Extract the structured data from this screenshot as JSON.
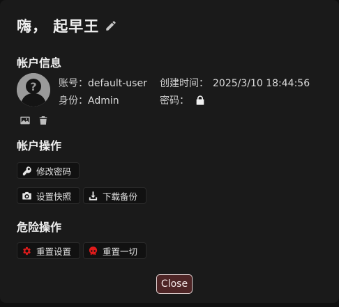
{
  "dialog": {
    "title": "嗨，  起早王",
    "edit_icon": "pencil-icon"
  },
  "account_info": {
    "heading": "帐户信息",
    "account_label": "账号：",
    "account_value": "default-user",
    "created_label": "创建时间：",
    "created_value": "2025/3/10 18:44:56",
    "role_label": "身份：",
    "role_value": "Admin",
    "password_label": "密码：",
    "password_icon": "lock-icon",
    "avatar_actions": [
      "image-icon",
      "trash-icon"
    ]
  },
  "account_ops": {
    "heading": "帐户操作",
    "change_password": "修改密码",
    "set_snapshot": "设置快照",
    "download_backup": "下载备份"
  },
  "danger_ops": {
    "heading": "危险操作",
    "reset_settings": "重置设置",
    "reset_all": "重置一切",
    "danger_color": "#e01b1b"
  },
  "footer": {
    "close": "Close"
  }
}
